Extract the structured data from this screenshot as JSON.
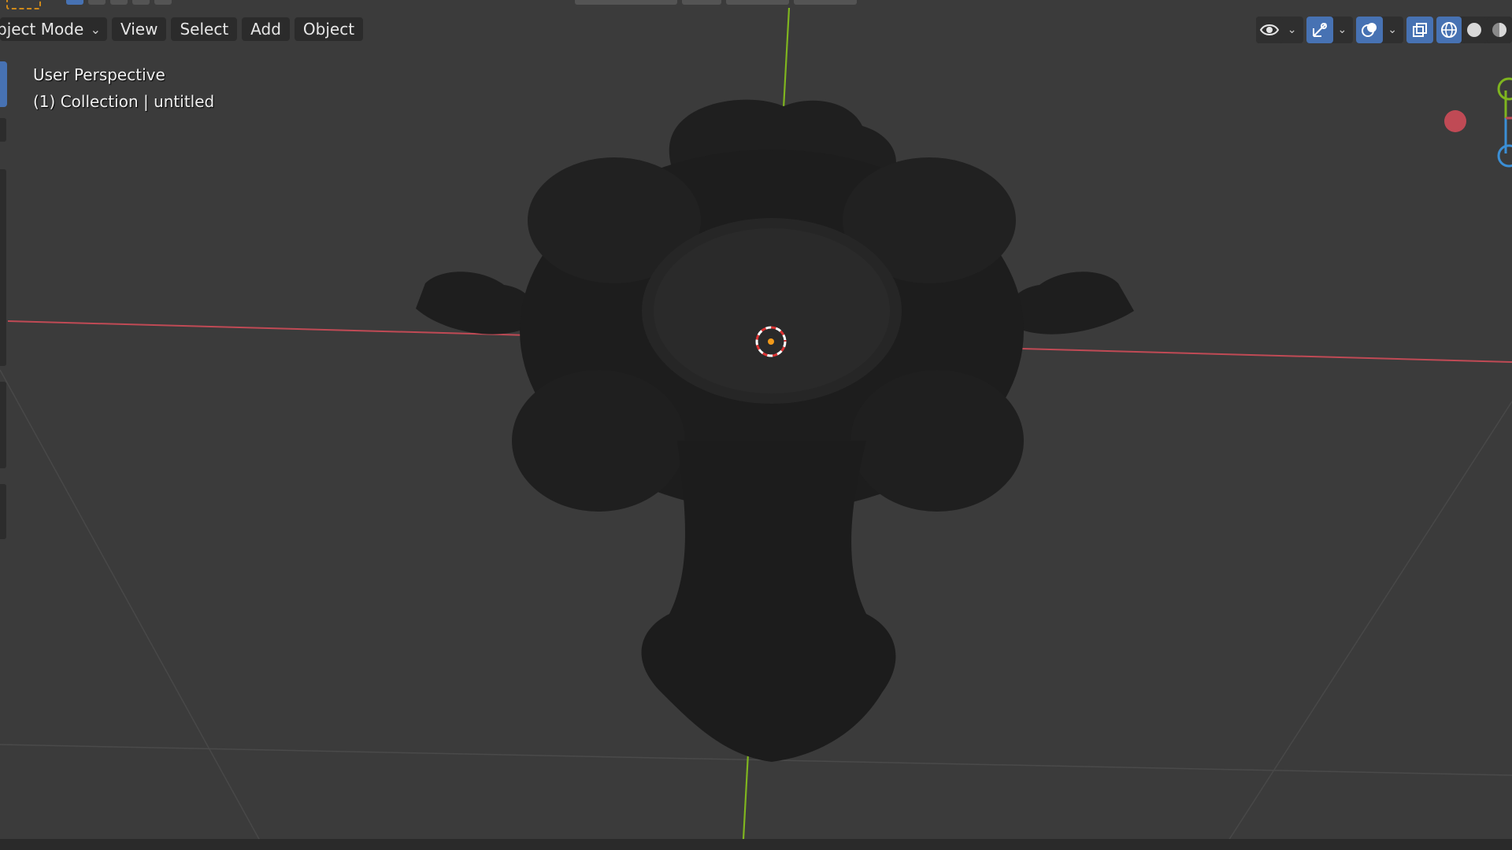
{
  "header": {
    "mode_label": "bject Mode",
    "menus": [
      "View",
      "Select",
      "Add",
      "Object"
    ]
  },
  "viewport_overlay": {
    "line1": "User Perspective",
    "line2": "(1) Collection | untitled"
  },
  "right_toolbar": {
    "icons": [
      "visibility-eye-icon",
      "gizmo-toggle-icon",
      "overlay-toggle-icon",
      "xray-toggle-icon",
      "wireframe-shading-icon",
      "solid-shading-icon",
      "material-shading-icon"
    ]
  },
  "colors": {
    "viewport_bg": "#3b3b3b",
    "x_axis": "#c04a55",
    "y_axis": "#7fb51f",
    "accent_blue": "#4772b3",
    "object": "#1d1d1d"
  }
}
